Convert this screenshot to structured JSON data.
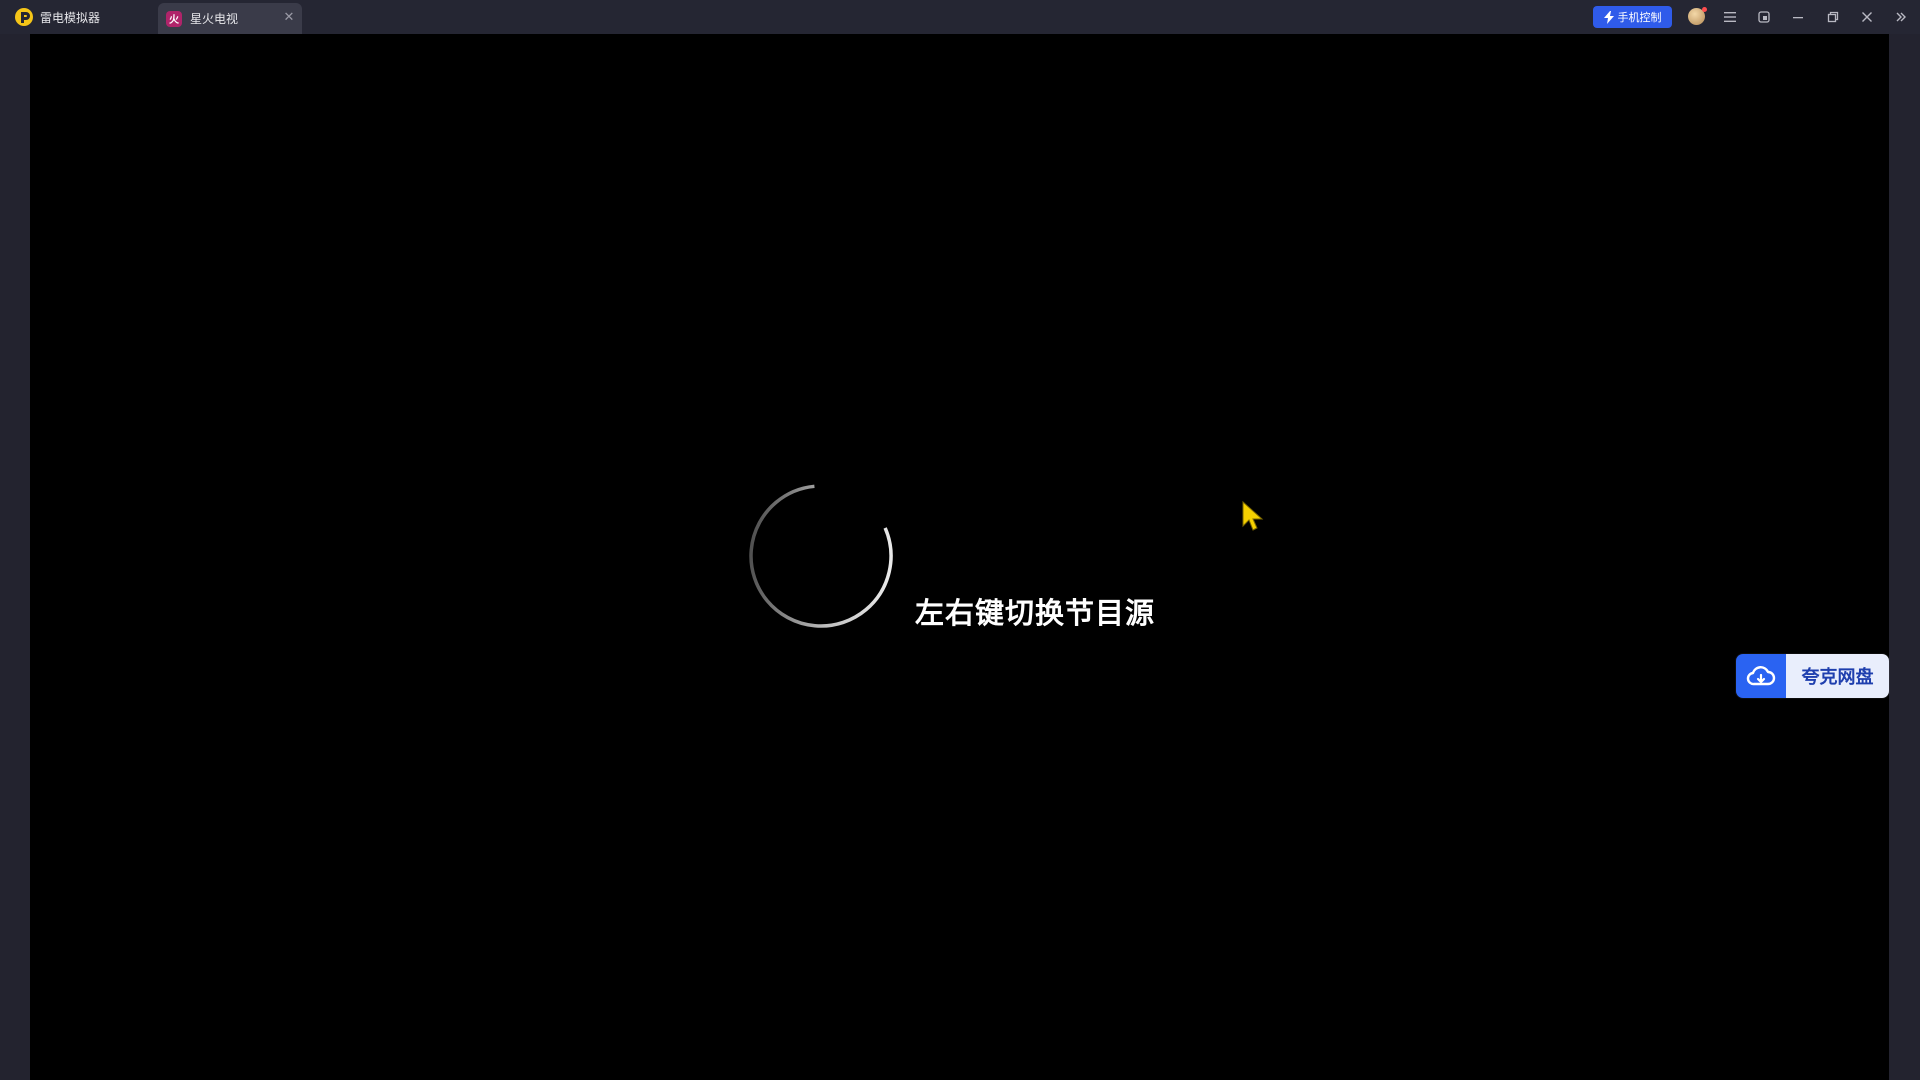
{
  "titlebar": {
    "home_tab_label": "雷电模拟器",
    "active_tab_label": "星火电视",
    "active_tab_icon_glyph": "火",
    "close_glyph": "✕",
    "phone_control_label": "手机控制",
    "colors": {
      "titlebar_bg": "#252633",
      "active_tab_bg": "#3a3b49",
      "phone_control_bg": "#2f5bea",
      "app_icon_bg": "#b0246a",
      "logo_yellow": "#f5c518"
    }
  },
  "screen": {
    "hint_text": "左右键切换节目源",
    "loading": true
  },
  "quark_drive": {
    "label": "夸克网盘",
    "icon": "cloud-icon",
    "colors": {
      "icon_bg": "#2a63f2",
      "label_bg": "#e9eefc",
      "label_text": "#1f3fae"
    }
  },
  "cursor": {
    "icon": "mouse-pointer-icon",
    "color": "#f5d000"
  }
}
